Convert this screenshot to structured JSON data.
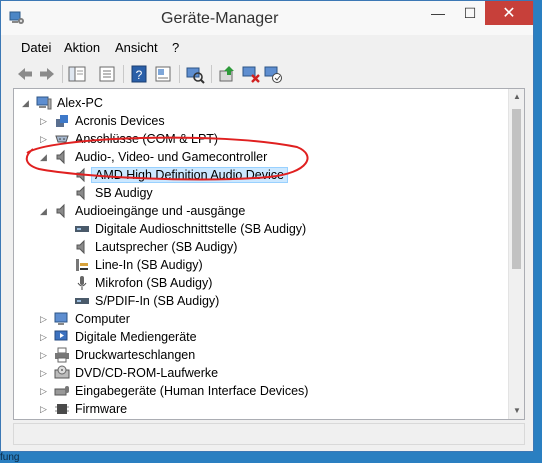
{
  "window": {
    "title": "Geräte-Manager",
    "controls": {
      "minimize": "—",
      "maximize": "☐",
      "close": "✕"
    }
  },
  "menu": [
    "Datei",
    "Aktion",
    "Ansicht",
    "?"
  ],
  "toolbar": [
    "back-icon",
    "forward-icon",
    "show-hide-tree-icon",
    "properties-icon",
    "help-icon",
    "update-driver-icon",
    "scan-hardware-icon",
    "enable-device-icon",
    "disable-device-icon",
    "uninstall-device-icon"
  ],
  "tree": {
    "root": "Alex-PC",
    "items": [
      {
        "label": "Acronis Devices",
        "icon": "acronis-icon",
        "expanded": false
      },
      {
        "label": "Anschlüsse (COM & LPT)",
        "icon": "port-icon",
        "expanded": false
      },
      {
        "label": "Audio-, Video- und Gamecontroller",
        "icon": "speaker-icon",
        "expanded": true
      },
      {
        "label": "AMD High Definition Audio Device",
        "icon": "speaker-device-icon",
        "child": true,
        "selected": true
      },
      {
        "label": "SB Audigy",
        "icon": "speaker-device-icon",
        "child": true
      },
      {
        "label": "Audioeingänge und -ausgänge",
        "icon": "speaker-icon",
        "expanded": true
      },
      {
        "label": "Digitale Audioschnittstelle (SB Audigy)",
        "icon": "digital-audio-icon",
        "child": true
      },
      {
        "label": "Lautsprecher (SB Audigy)",
        "icon": "speaker-device-icon",
        "child": true
      },
      {
        "label": "Line-In (SB Audigy)",
        "icon": "line-in-icon",
        "child": true
      },
      {
        "label": "Mikrofon (SB Audigy)",
        "icon": "microphone-icon",
        "child": true
      },
      {
        "label": "S/PDIF-In (SB Audigy)",
        "icon": "digital-audio-icon",
        "child": true
      },
      {
        "label": "Computer",
        "icon": "computer-icon",
        "expanded": false
      },
      {
        "label": "Digitale Mediengeräte",
        "icon": "media-device-icon",
        "expanded": false
      },
      {
        "label": "Druckwarteschlangen",
        "icon": "printer-icon",
        "expanded": false
      },
      {
        "label": "DVD/CD-ROM-Laufwerke",
        "icon": "disc-drive-icon",
        "expanded": false
      },
      {
        "label": "Eingabegeräte (Human Interface Devices)",
        "icon": "hid-icon",
        "expanded": false
      },
      {
        "label": "Firmware",
        "icon": "firmware-icon",
        "expanded": false
      }
    ]
  },
  "colors": {
    "annotation": "#e02020",
    "selection": "#cce8ff",
    "close_button": "#c7403a"
  },
  "edge_text": "fung"
}
